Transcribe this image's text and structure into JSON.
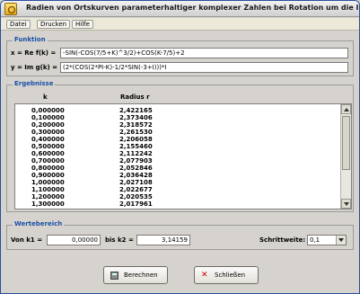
{
  "window": {
    "title": "Radien von Ortskurven parameterhaltiger komplexer Zahlen bei Rotation um die Im-Achse"
  },
  "menu": {
    "items": [
      "Datei",
      "Drucken",
      "Hilfe"
    ]
  },
  "funktion": {
    "group_label": "Funktion",
    "x_label": "x = Re f(k) =",
    "x_value": "-SIN(-COS(7/5+K)^3/2)+COS(K-7/5)+2",
    "y_label": "y = Im g(k) =",
    "y_value": "(2*(COS(2*PI-K)-1/2*SIN(-3+I)))*I"
  },
  "ergebnisse": {
    "group_label": "Ergebnisse",
    "col_k": "k",
    "col_r": "Radius r",
    "rows": [
      {
        "k": "0,000000",
        "r": "2,422165"
      },
      {
        "k": "0,100000",
        "r": "2,373406"
      },
      {
        "k": "0,200000",
        "r": "2,318572"
      },
      {
        "k": "0,300000",
        "r": "2,261530"
      },
      {
        "k": "0,400000",
        "r": "2,206058"
      },
      {
        "k": "0,500000",
        "r": "2,155460"
      },
      {
        "k": "0,600000",
        "r": "2,112242"
      },
      {
        "k": "0,700000",
        "r": "2,077903"
      },
      {
        "k": "0,800000",
        "r": "2,052846"
      },
      {
        "k": "0,900000",
        "r": "2,036428"
      },
      {
        "k": "1,000000",
        "r": "2,027108"
      },
      {
        "k": "1,100000",
        "r": "2,022677"
      },
      {
        "k": "1,200000",
        "r": "2,020535"
      },
      {
        "k": "1,300000",
        "r": "2,017961"
      }
    ]
  },
  "wertebereich": {
    "group_label": "Wertebereich",
    "from_label": "Von k1 =",
    "from_value": "0,00000",
    "to_label": "bis k2 =",
    "to_value": "3,14159",
    "step_label": "Schrittweite:",
    "step_value": "0,1"
  },
  "buttons": {
    "calculate": "Berechnen",
    "close": "Schließen"
  }
}
